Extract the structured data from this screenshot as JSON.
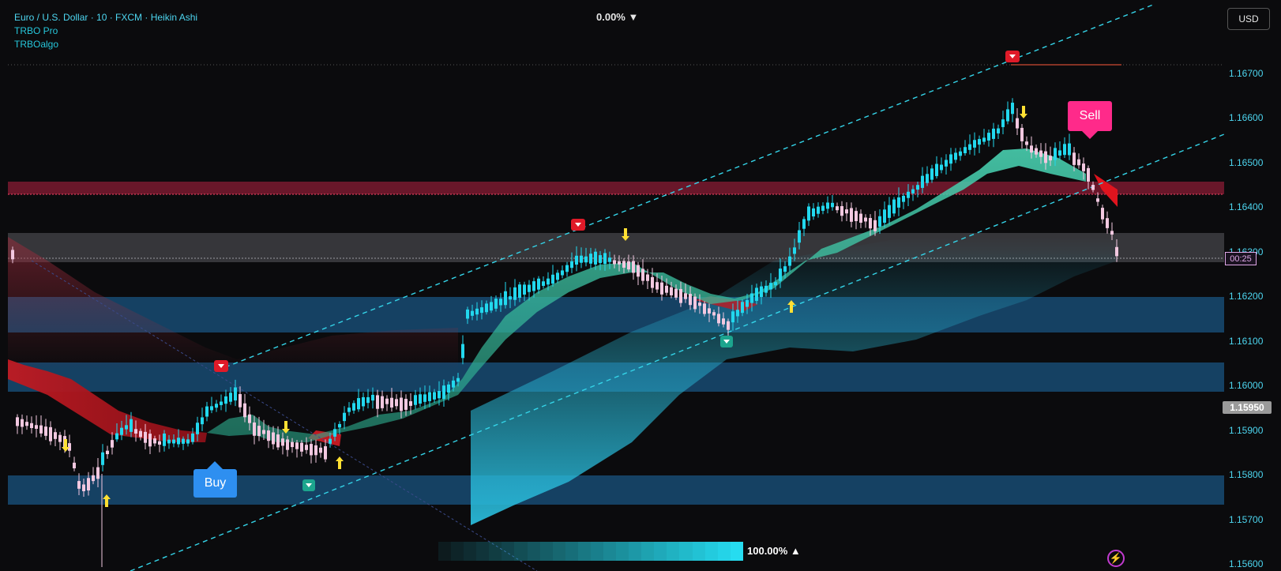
{
  "header": {
    "symbol_line": "Euro / U.S. Dollar · 10 · FXCM · Heikin Ashi",
    "indicator_1": "TRBO Pro",
    "indicator_2": "TRBOalgo",
    "change_pct": "0.00% ▼",
    "currency_button": "USD"
  },
  "price_axis": {
    "ticks": [
      "1.16700",
      "1.16600",
      "1.16500",
      "1.16400",
      "1.16300",
      "1.16200",
      "1.16100",
      "1.16000",
      "1.15900",
      "1.15800",
      "1.15700",
      "1.15600"
    ],
    "current_price": "1.15950",
    "countdown": "00:25"
  },
  "signals": {
    "buy_label": "Buy",
    "sell_label": "Sell"
  },
  "heatmap": {
    "pct_label": "100.00% ▲"
  },
  "colors": {
    "background": "#0b0b0d",
    "bull_candle": "#22d8ee",
    "bear_candle": "#f2c8e0",
    "bull_cloud": "#3fbfa0",
    "bear_cloud": "#c01a22",
    "zone_blue": "#1f6fa8",
    "zone_red": "#a0203c",
    "buy_bubble": "#2e8ff0",
    "sell_bubble": "#ff2a8a",
    "arrow_yellow": "#ffe033"
  },
  "icons": {
    "alert": "lightning-icon",
    "sell_marker": "down-triangle-marker",
    "buy_marker": "up-triangle-marker"
  }
}
